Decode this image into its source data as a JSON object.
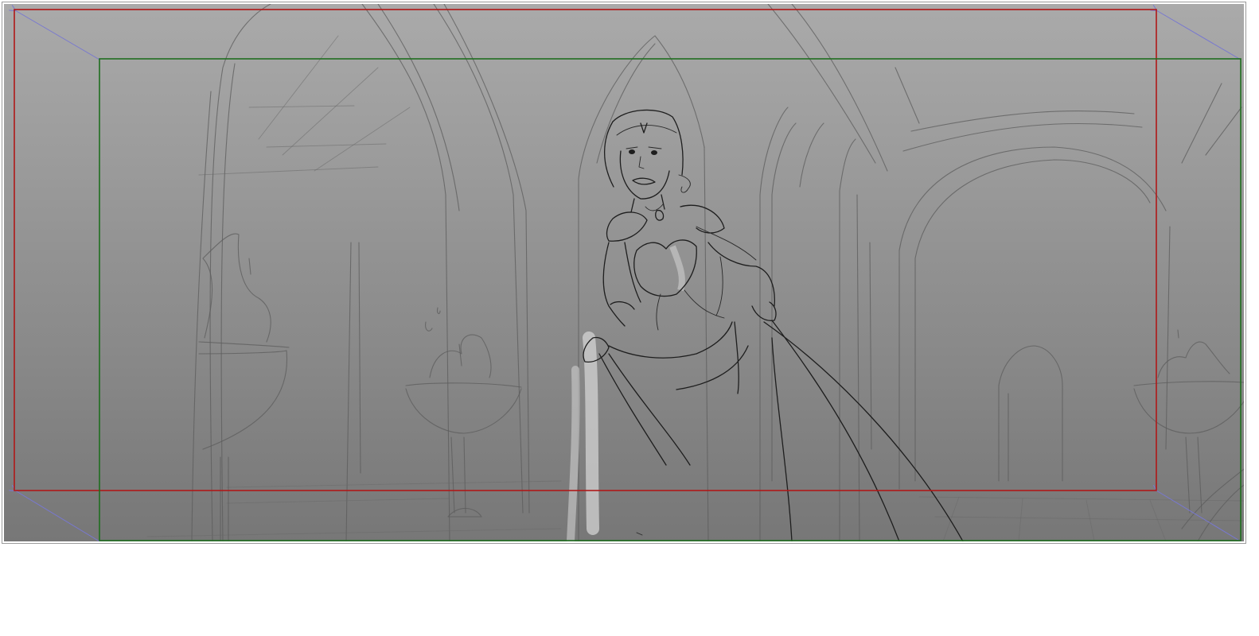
{
  "scene": {
    "kind": "storyboard-panel",
    "subject": "pencil-sketch",
    "background_gradient": {
      "top": "#aaaaaa",
      "bottom": "#777777"
    }
  },
  "overlays": {
    "action_safe_color": "#b01818",
    "title_safe_color": "#1f6e1f",
    "camera_move_color": "#7878d0"
  },
  "icons": [
    "arrow-head-icon"
  ]
}
